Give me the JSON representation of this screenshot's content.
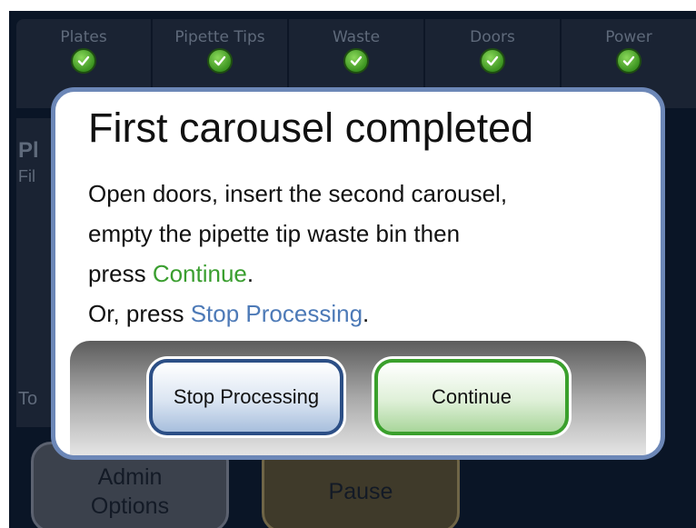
{
  "status_bar": {
    "items": [
      {
        "label": "Plates",
        "state": "ok"
      },
      {
        "label": "Pipette Tips",
        "state": "ok"
      },
      {
        "label": "Waste",
        "state": "ok"
      },
      {
        "label": "Doors",
        "state": "ok"
      },
      {
        "label": "Power",
        "state": "ok"
      }
    ],
    "ok_icon": "check-icon",
    "ok_color": "#4caf2a"
  },
  "background": {
    "panel_title_fragment": "Pl",
    "panel_subtitle_fragment": "Fil",
    "lower_label_fragment": "To",
    "admin_button": {
      "line1": "Admin",
      "line2": "Options"
    },
    "pause_button": "Pause"
  },
  "dialog": {
    "title": "First carousel completed",
    "line1": "Open doors, insert the second carousel,",
    "line2": "empty the pipette tip waste bin then",
    "line3_prefix": "press ",
    "line3_highlight": "Continue",
    "line3_suffix": ".",
    "line4_prefix": "Or, press ",
    "line4_highlight": "Stop Processing",
    "line4_suffix": ".",
    "stop_button": "Stop Processing",
    "continue_button": "Continue"
  },
  "colors": {
    "dialog_border": "#6c87b7",
    "continue_accent": "#3a9e2f",
    "stop_accent": "#4d7ab7"
  }
}
